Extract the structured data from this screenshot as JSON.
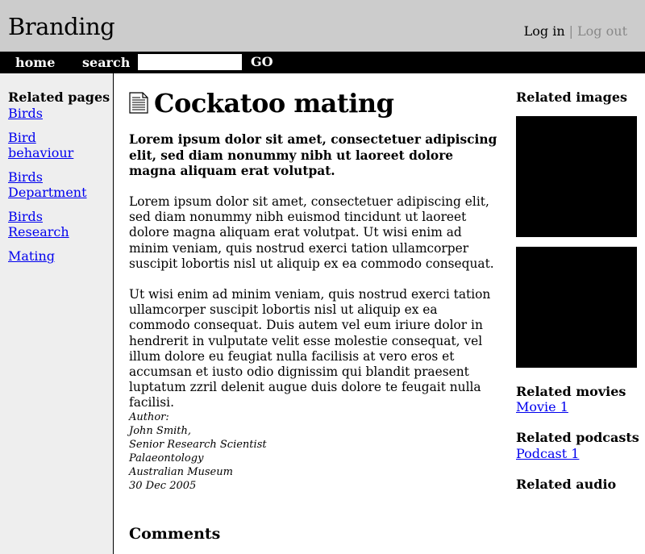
{
  "header": {
    "brand": "Branding",
    "login": "Log in",
    "separator": "|",
    "logout": "Log out"
  },
  "nav": {
    "home": "home",
    "search": "search",
    "search_value": "",
    "go": "GO"
  },
  "sidebar": {
    "heading": "Related pages",
    "items": [
      {
        "label": "Birds"
      },
      {
        "label": "Bird behaviour"
      },
      {
        "label": "Birds Department"
      },
      {
        "label": "Birds Research"
      },
      {
        "label": "Mating"
      }
    ]
  },
  "main": {
    "title": "Cockatoo mating",
    "lead": "Lorem ipsum dolor sit amet, consectetuer adipiscing elit, sed diam nonummy nibh ut laoreet dolore magna aliquam erat volutpat.",
    "paragraphs": [
      "Lorem ipsum dolor sit amet, consectetuer adipiscing elit, sed diam nonummy nibh euismod tincidunt ut laoreet dolore magna aliquam erat volutpat. Ut wisi enim ad minim veniam, quis nostrud exerci tation ullamcorper suscipit lobortis nisl ut aliquip ex ea commodo consequat.",
      "Ut wisi enim ad minim veniam, quis nostrud exerci tation ullamcorper suscipit lobortis nisl ut aliquip ex ea commodo consequat. Duis autem vel eum iriure dolor in hendrerit in vulputate velit esse molestie consequat, vel illum dolore eu feugiat nulla facilisis at vero eros et accumsan et iusto odio dignissim qui blandit praesent luptatum zzril delenit augue duis dolore te feugait nulla facilisi."
    ],
    "author": {
      "label": "Author:",
      "name": "John Smith,",
      "role": "Senior Research Scientist",
      "dept": "Palaeontology",
      "org": "Australian Museum",
      "date": "30 Dec 2005"
    },
    "comments_heading": "Comments"
  },
  "right": {
    "images_heading": "Related images",
    "movies_heading": "Related movies",
    "movie_link": "Movie 1",
    "podcasts_heading": "Related podcasts",
    "podcast_link": "Podcast 1",
    "audio_heading": "Related audio"
  },
  "icons": {
    "title_icon": "document-icon"
  }
}
